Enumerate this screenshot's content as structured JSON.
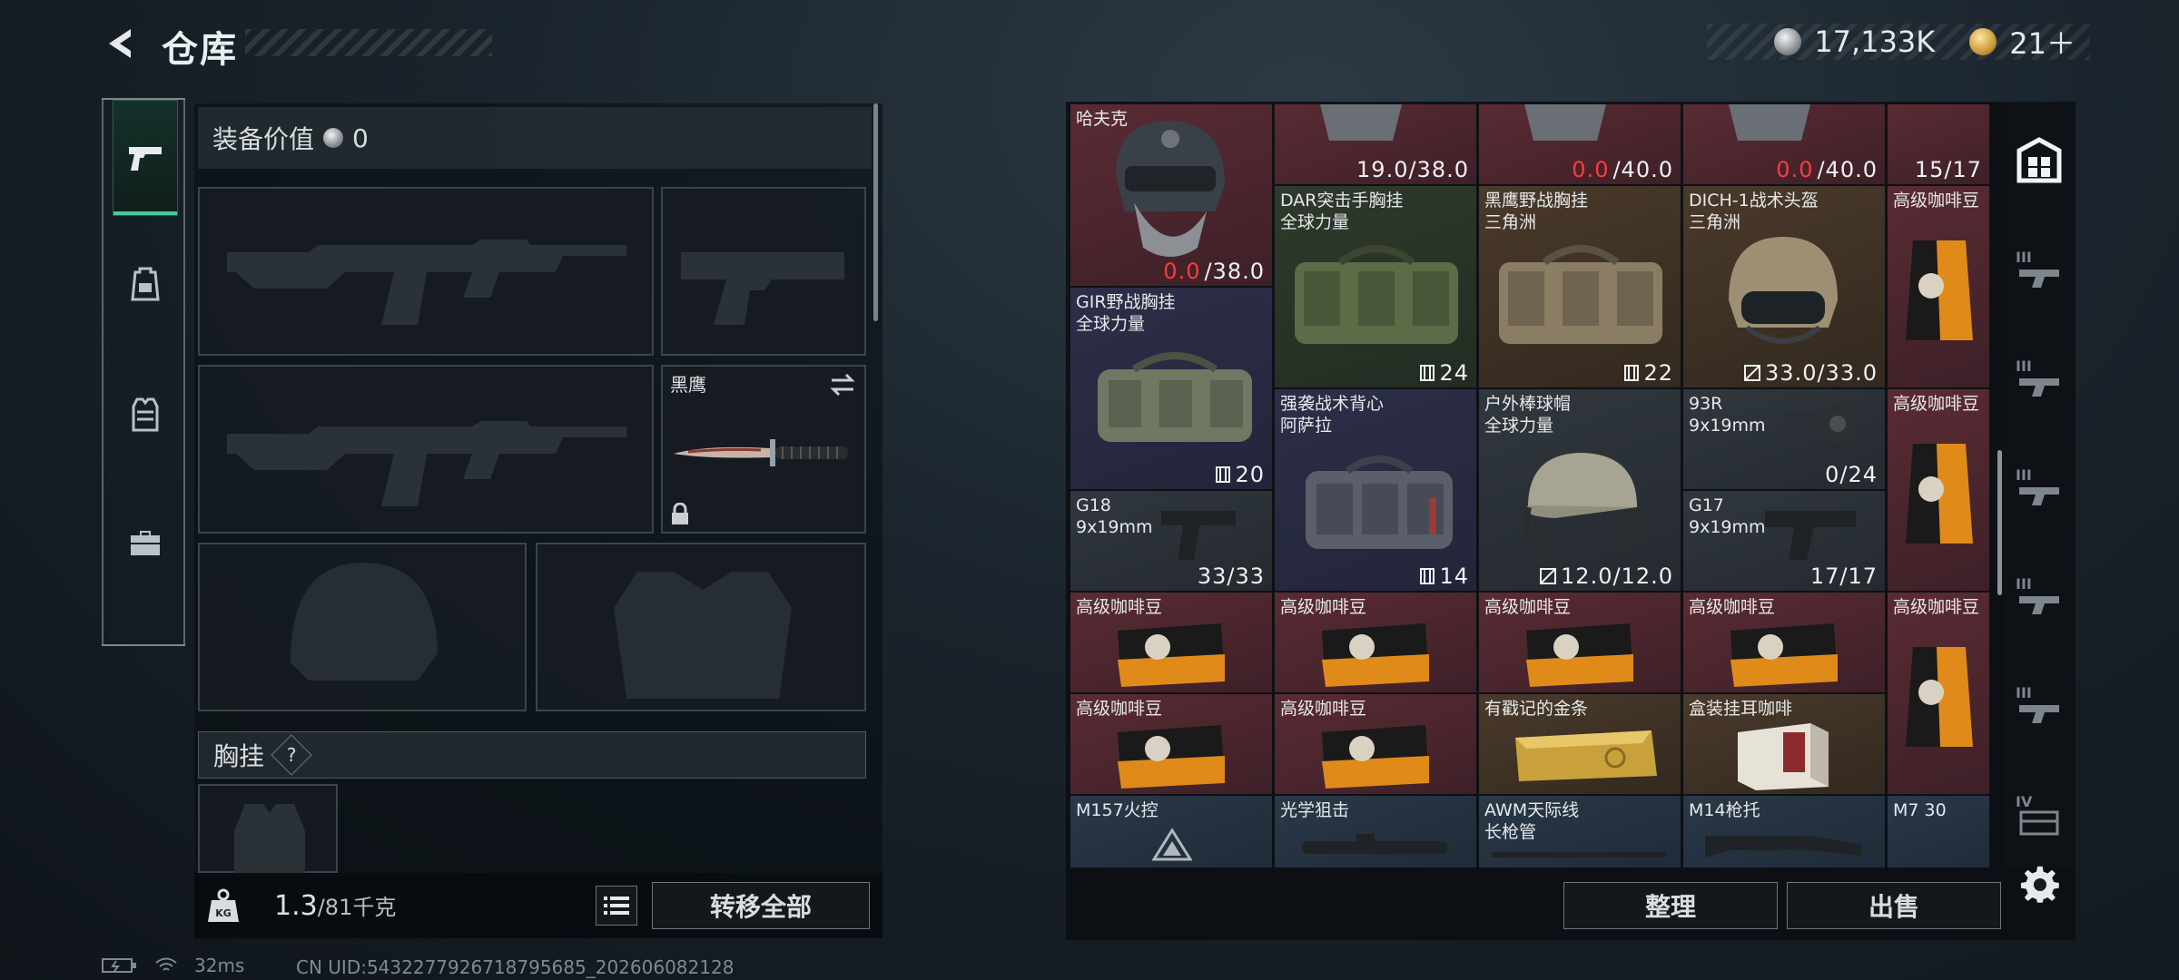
{
  "header": {
    "title": "仓库",
    "silver_amount": "17,133K",
    "gold_amount": "21＋"
  },
  "left": {
    "equipment_value_label": "装备价值",
    "equipment_value": "0",
    "knife_slot_label": "黑鹰",
    "chest_label": "胸挂",
    "chest_help": "?",
    "weight_current": "1.3",
    "weight_max": "/81千克",
    "transfer_all": "转移全部"
  },
  "storage": {
    "items": [
      {
        "name": "哈夫克",
        "name2": "",
        "value_red": "0.0",
        "value": "/38.0"
      },
      {
        "name": "",
        "name2": "",
        "value_red": "",
        "value": "19.0/38.0"
      },
      {
        "name": "",
        "name2": "",
        "value_red": "0.0",
        "value": "/40.0"
      },
      {
        "name": "",
        "name2": "",
        "value_red": "0.0",
        "value": "/40.0"
      },
      {
        "name": "",
        "name2": "",
        "value_red": "",
        "value": "15/17"
      },
      {
        "name": "DAR突击手胸挂",
        "name2": "全球力量",
        "value": "24"
      },
      {
        "name": "黑鹰野战胸挂",
        "name2": "三角洲",
        "value": "22"
      },
      {
        "name": "DICH-1战术头盔",
        "name2": "三角洲",
        "value": "33.0/33.0"
      },
      {
        "name": "高级咖啡豆",
        "name2": ""
      },
      {
        "name": "GIR野战胸挂",
        "name2": "全球力量",
        "value": "20"
      },
      {
        "name": "强袭战术背心",
        "name2": "阿萨拉",
        "value": "14"
      },
      {
        "name": "户外棒球帽",
        "name2": "全球力量",
        "value": "12.0/12.0"
      },
      {
        "name": "93R",
        "name2": "9x19mm",
        "value": "0/24"
      },
      {
        "name": "高级咖啡豆",
        "name2": ""
      },
      {
        "name": "G18",
        "name2": "9x19mm",
        "value": "33/33"
      },
      {
        "name": "G17",
        "name2": "9x19mm",
        "value": "17/17"
      },
      {
        "name": "高级咖啡豆",
        "name2": ""
      },
      {
        "name": "高级咖啡豆",
        "name2": ""
      },
      {
        "name": "高级咖啡豆",
        "name2": ""
      },
      {
        "name": "高级咖啡豆",
        "name2": ""
      },
      {
        "name": "高级咖啡豆",
        "name2": ""
      },
      {
        "name": "高级咖啡豆",
        "name2": ""
      },
      {
        "name": "高级咖啡豆",
        "name2": ""
      },
      {
        "name": "有戳记的金条",
        "name2": ""
      },
      {
        "name": "盒装挂耳咖啡",
        "name2": ""
      },
      {
        "name": "M157火控",
        "name2": ""
      },
      {
        "name": "光学狙击",
        "name2": ""
      },
      {
        "name": "AWM天际线",
        "name2": "长枪管"
      },
      {
        "name": "M14枪托",
        "name2": ""
      },
      {
        "name": "M7 30",
        "name2": ""
      }
    ],
    "organize": "整理",
    "sell": "出售"
  },
  "right_tabs": [
    "II",
    "III",
    "III",
    "III",
    "III",
    "III",
    "IV"
  ],
  "status": {
    "ping": "32ms",
    "uid": "CN UID:5432277926718795685_202606082128"
  },
  "colors": {
    "accent": "#45c9a0",
    "durability_zero": "#ff3b3b"
  }
}
